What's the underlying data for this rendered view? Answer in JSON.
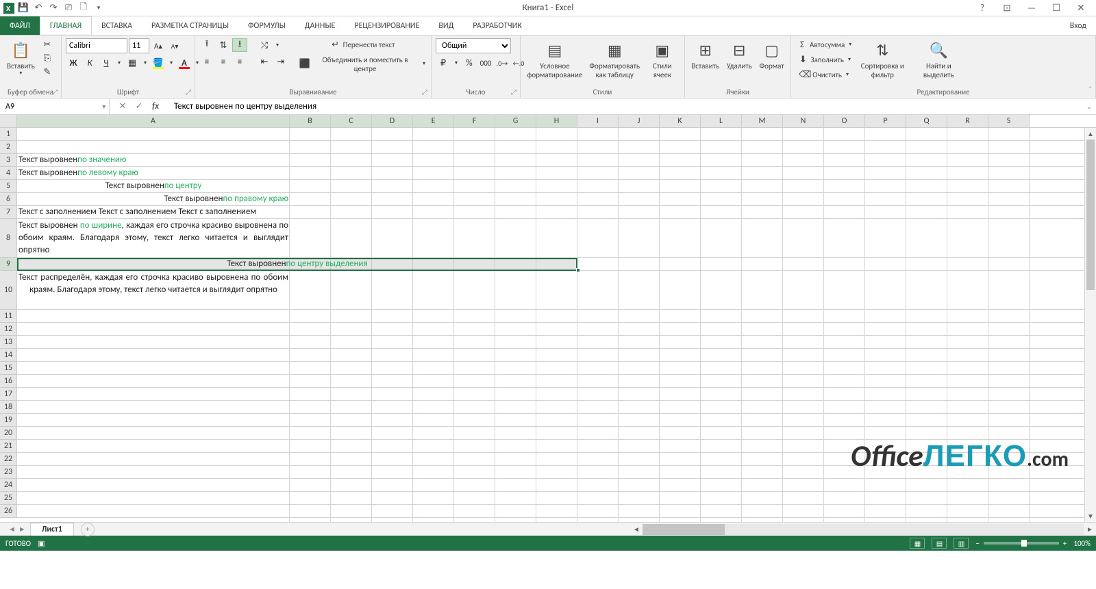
{
  "app": {
    "title": "Книга1 - Excel",
    "login": "Вход"
  },
  "tabs": {
    "file": "ФАЙЛ",
    "home": "ГЛАВНАЯ",
    "insert": "ВСТАВКА",
    "layout": "РАЗМЕТКА СТРАНИЦЫ",
    "formulas": "ФОРМУЛЫ",
    "data": "ДАННЫЕ",
    "review": "РЕЦЕНЗИРОВАНИЕ",
    "view": "ВИД",
    "dev": "РАЗРАБОТЧИК"
  },
  "ribbon": {
    "clipboard": {
      "paste": "Вставить",
      "label": "Буфер обмена"
    },
    "font": {
      "name": "Calibri",
      "size": "11",
      "label": "Шрифт"
    },
    "align": {
      "wrap": "Перенести текст",
      "merge": "Объединить и поместить в центре",
      "label": "Выравнивание"
    },
    "number": {
      "format": "Общий",
      "label": "Число"
    },
    "styles": {
      "cond": "Условное форматирование",
      "table": "Форматировать как таблицу",
      "cell": "Стили ячеек",
      "label": "Стили"
    },
    "cells": {
      "insert": "Вставить",
      "delete": "Удалить",
      "format": "Формат",
      "label": "Ячейки"
    },
    "editing": {
      "sum": "Автосумма",
      "fill": "Заполнить",
      "clear": "Очистить",
      "sort": "Сортировка и фильтр",
      "find": "Найти и выделить",
      "label": "Редактирование"
    }
  },
  "namebox": "A9",
  "formula": "Текст выровнен по центру выделения",
  "columns": [
    "A",
    "B",
    "C",
    "D",
    "E",
    "F",
    "G",
    "H",
    "I",
    "J",
    "K",
    "L",
    "M",
    "N",
    "O",
    "P",
    "Q",
    "R",
    "S"
  ],
  "cells": {
    "r3_pre": "Текст выровнен ",
    "r3_hl": "по значению",
    "r4_pre": "Текст выровнен ",
    "r4_hl": "по левому краю",
    "r5_pre": "Текст выровнен ",
    "r5_hl": "по центру",
    "r6_pre": "Текст выровнен ",
    "r6_hl": "по правому краю",
    "r7": "Текст с заполнением Текст с заполнением Текст с заполнением",
    "r8_pre": "Текст выровнен ",
    "r8_hl": "по ширине",
    "r8_post": ", каждая его строчка красиво выровнена по обоим краям. Благодаря этому, текст легко читается и выглядит опрятно",
    "r9_pre": "Текст выровнен ",
    "r9_hl": "по центру выделения",
    "r10": "Текст распределён, каждая его строчка красиво выровнена по обоим краям. Благодаря этому, текст легко читается и выглядит опрятно"
  },
  "sheet": {
    "name": "Лист1"
  },
  "status": {
    "ready": "ГОТОВО",
    "zoom": "100%"
  },
  "watermark": {
    "p1": "Office",
    "p2": "ЛЕГКО",
    "p3": ".com"
  }
}
